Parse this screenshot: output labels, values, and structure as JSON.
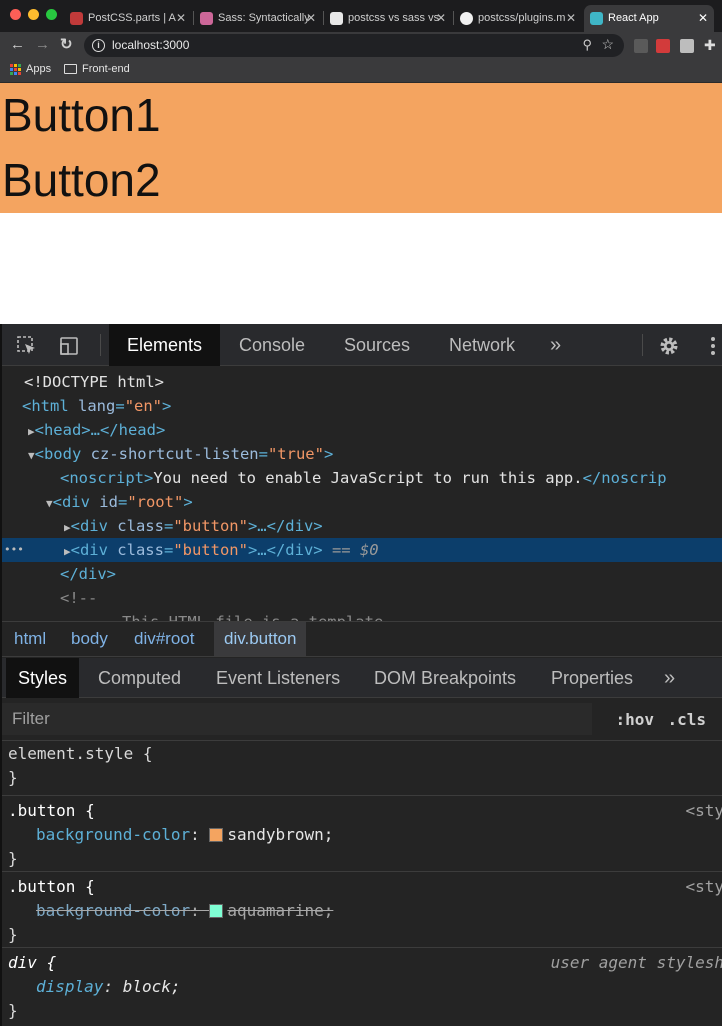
{
  "browser": {
    "tabs": [
      {
        "title": "PostCSS.parts | A"
      },
      {
        "title": "Sass: Syntactically"
      },
      {
        "title": "postcss vs sass vs"
      },
      {
        "title": "postcss/plugins.m"
      },
      {
        "title": "React App"
      }
    ],
    "tab_close": "✕",
    "nav": {
      "back": "←",
      "forward": "→",
      "reload": "↻"
    },
    "url": "localhost:3000",
    "bookmarks": [
      {
        "label": "Apps"
      },
      {
        "label": "Front-end"
      }
    ]
  },
  "page": {
    "buttons": [
      "Button1",
      "Button2"
    ],
    "button_color": "#f4a460"
  },
  "devtools": {
    "tabs": [
      "Elements",
      "Console",
      "Sources",
      "Network"
    ],
    "more": "»",
    "dom": {
      "doctype": "<!DOCTYPE html>",
      "html_open": "<html",
      "html_attr": "lang",
      "html_val": "\"en\"",
      "head": "<head>…</head>",
      "body_open": "<body",
      "body_attr": "cz-shortcut-listen",
      "body_val": "\"true\"",
      "noscript_open": "<noscript>",
      "noscript_text": "You need to enable JavaScript to run this app.",
      "noscript_close": "</noscrip",
      "div_root_open": "<div",
      "div_root_attr": "id",
      "div_root_val": "\"root\"",
      "div_btn_open": "<div",
      "div_btn_attr": "class",
      "div_btn_val": "\"button\"",
      "div_btn_rest": ">…</div>",
      "selected_marker": "== $0",
      "div_close": "</div>",
      "comment_open": "<!--",
      "comment_text": "This HTML file is a template",
      "dots": "•••"
    },
    "breadcrumbs": [
      "html",
      "body",
      "div#root",
      "div.button"
    ],
    "sub_tabs": [
      "Styles",
      "Computed",
      "Event Listeners",
      "DOM Breakpoints",
      "Properties"
    ],
    "filter_placeholder": "Filter",
    "hov": ":hov",
    "cls": ".cls",
    "rules": {
      "element_style": "element.style {",
      "close_brace": "}",
      "rule1": {
        "selector": ".button {",
        "prop": "background-color",
        "value": "sandybrown;",
        "source": "<sty",
        "swatch": "#f4a460"
      },
      "rule2": {
        "selector": ".button {",
        "prop": "background-color",
        "value": "aquamarine;",
        "source": "<sty",
        "swatch": "#7fffd4"
      },
      "rule3": {
        "selector": "div {",
        "prop": "display",
        "value": "block;",
        "source": "user agent stylesh"
      }
    }
  }
}
